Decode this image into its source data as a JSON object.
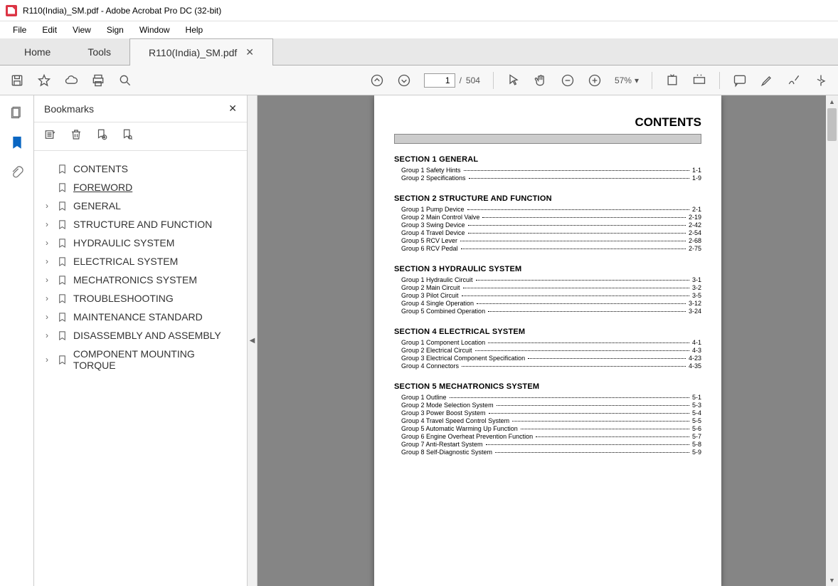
{
  "window": {
    "title": "R110(India)_SM.pdf - Adobe Acrobat Pro DC (32-bit)"
  },
  "menu": [
    "File",
    "Edit",
    "View",
    "Sign",
    "Window",
    "Help"
  ],
  "tabs": {
    "home": "Home",
    "tools": "Tools",
    "doc": "R110(India)_SM.pdf"
  },
  "toolbar": {
    "page_current": "1",
    "page_total": "504",
    "zoom": "57%",
    "zoom_caret": "▾"
  },
  "bm": {
    "title": "Bookmarks",
    "items": [
      {
        "label": "CONTENTS",
        "expand": false,
        "chev": ""
      },
      {
        "label": "FOREWORD",
        "expand": false,
        "chev": "",
        "active": true
      },
      {
        "label": "GENERAL",
        "expand": true,
        "chev": "›"
      },
      {
        "label": "STRUCTURE AND FUNCTION",
        "expand": true,
        "chev": "›"
      },
      {
        "label": "HYDRAULIC SYSTEM",
        "expand": true,
        "chev": "›"
      },
      {
        "label": "ELECTRICAL SYSTEM",
        "expand": true,
        "chev": "›"
      },
      {
        "label": "MECHATRONICS SYSTEM",
        "expand": true,
        "chev": "›"
      },
      {
        "label": "TROUBLESHOOTING",
        "expand": true,
        "chev": "›"
      },
      {
        "label": "MAINTENANCE STANDARD",
        "expand": true,
        "chev": "›"
      },
      {
        "label": "DISASSEMBLY AND ASSEMBLY",
        "expand": true,
        "chev": "›"
      },
      {
        "label": "COMPONENT MOUNTING TORQUE",
        "expand": true,
        "chev": "›"
      }
    ]
  },
  "doc": {
    "title": "CONTENTS",
    "sections": [
      {
        "head": "SECTION 1  GENERAL",
        "rows": [
          {
            "g": "Group  1  Safety Hints",
            "p": "1-1"
          },
          {
            "g": "Group  2  Specifications",
            "p": "1-9"
          }
        ]
      },
      {
        "head": "SECTION 2  STRUCTURE AND FUNCTION",
        "rows": [
          {
            "g": "Group  1  Pump Device",
            "p": "2-1"
          },
          {
            "g": "Group  2  Main Control Valve",
            "p": "2-19"
          },
          {
            "g": "Group  3  Swing Device",
            "p": "2-42"
          },
          {
            "g": "Group  4  Travel Device",
            "p": "2-54"
          },
          {
            "g": "Group  5  RCV Lever",
            "p": "2-68"
          },
          {
            "g": "Group  6  RCV Pedal",
            "p": "2-75"
          }
        ]
      },
      {
        "head": "SECTION 3  HYDRAULIC SYSTEM",
        "rows": [
          {
            "g": "Group  1  Hydraulic Circuit",
            "p": "3-1"
          },
          {
            "g": "Group  2  Main Circuit",
            "p": "3-2"
          },
          {
            "g": "Group  3  Pilot Circuit",
            "p": "3-5"
          },
          {
            "g": "Group  4  Single Operation",
            "p": "3-12"
          },
          {
            "g": "Group  5  Combined Operation",
            "p": "3-24"
          }
        ]
      },
      {
        "head": "SECTION 4  ELECTRICAL SYSTEM",
        "rows": [
          {
            "g": "Group  1  Component Location",
            "p": "4-1"
          },
          {
            "g": "Group  2  Electrical Circuit",
            "p": "4-3"
          },
          {
            "g": "Group  3  Electrical Component Specification",
            "p": "4-23"
          },
          {
            "g": "Group  4  Connectors",
            "p": "4-35"
          }
        ]
      },
      {
        "head": "SECTION 5  MECHATRONICS SYSTEM",
        "rows": [
          {
            "g": "Group  1  Outline",
            "p": "5-1"
          },
          {
            "g": "Group  2  Mode Selection System",
            "p": "5-3"
          },
          {
            "g": "Group  3  Power Boost System",
            "p": "5-4"
          },
          {
            "g": "Group  4  Travel Speed Control System",
            "p": "5-5"
          },
          {
            "g": "Group  5  Automatic Warming Up Function",
            "p": "5-6"
          },
          {
            "g": "Group  6  Engine Overheat Prevention Function",
            "p": "5-7"
          },
          {
            "g": "Group  7  Anti-Restart System",
            "p": "5-8"
          },
          {
            "g": "Group  8  Self-Diagnostic System",
            "p": "5-9"
          }
        ]
      }
    ]
  }
}
